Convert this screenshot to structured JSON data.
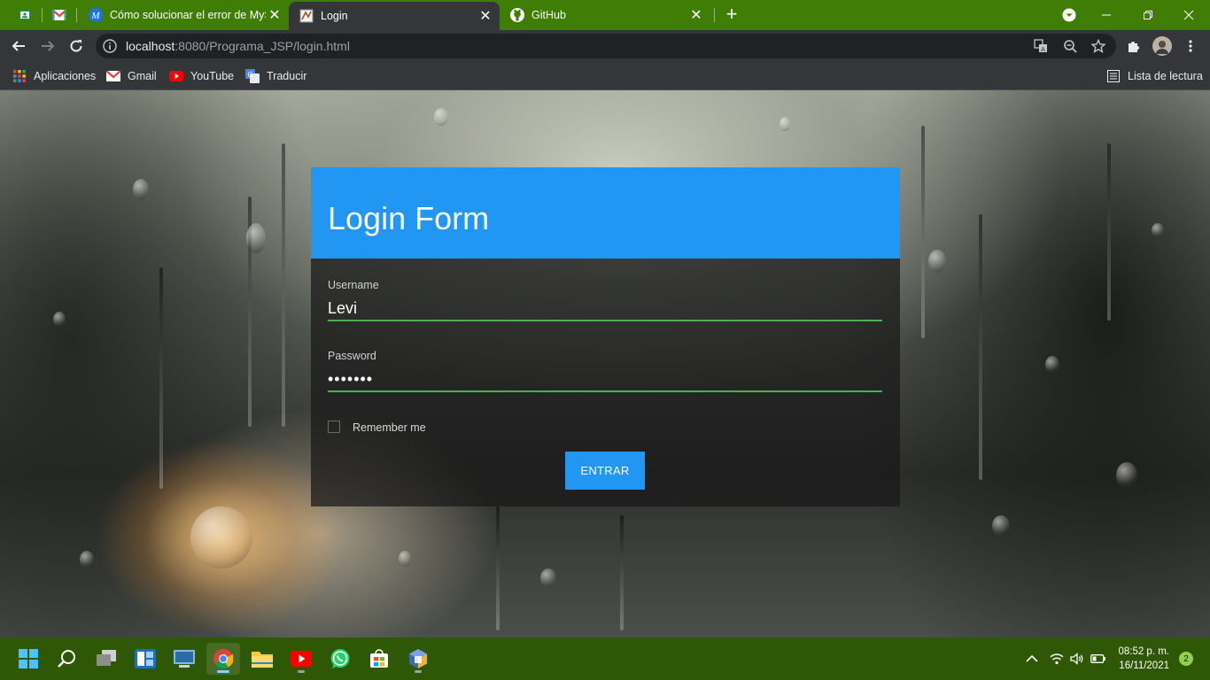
{
  "browser": {
    "tabs": [
      {
        "title": "Cómo solucionar el error de MyS",
        "icon": "mysql-site-icon",
        "active": false
      },
      {
        "title": "Login",
        "icon": "page-icon",
        "active": true
      },
      {
        "title": "GitHub",
        "icon": "github-icon",
        "active": false
      }
    ],
    "new_tab_glyph": "+",
    "close_glyph": "✕",
    "address": {
      "host": "localhost",
      "path": ":8080/Programa_JSP/login.html"
    },
    "bookmarks": [
      {
        "label": "Aplicaciones",
        "icon": "apps-grid-icon"
      },
      {
        "label": "Gmail",
        "icon": "gmail-icon"
      },
      {
        "label": "YouTube",
        "icon": "youtube-icon"
      },
      {
        "label": "Traducir",
        "icon": "translate-icon"
      }
    ],
    "reading_list_label": "Lista de lectura",
    "theme_color": "#3f7d07"
  },
  "login": {
    "title": "Login Form",
    "username_label": "Username",
    "username_value": "Levi",
    "password_label": "Password",
    "password_value": "•••••••",
    "remember_label": "Remember me",
    "remember_checked": false,
    "submit_label": "ENTRAR",
    "accent_color": "#2196f3",
    "underline_color": "#4caf50"
  },
  "taskbar": {
    "apps": [
      "start-icon",
      "search-icon",
      "task-view-icon",
      "widgets-icon",
      "remote-desktop-icon",
      "chrome-icon",
      "file-explorer-icon",
      "youtube-app-icon",
      "whatsapp-icon",
      "store-icon",
      "virtualbox-icon"
    ],
    "time": "08:52 p. m.",
    "date": "16/11/2021",
    "notification_count": "2"
  }
}
